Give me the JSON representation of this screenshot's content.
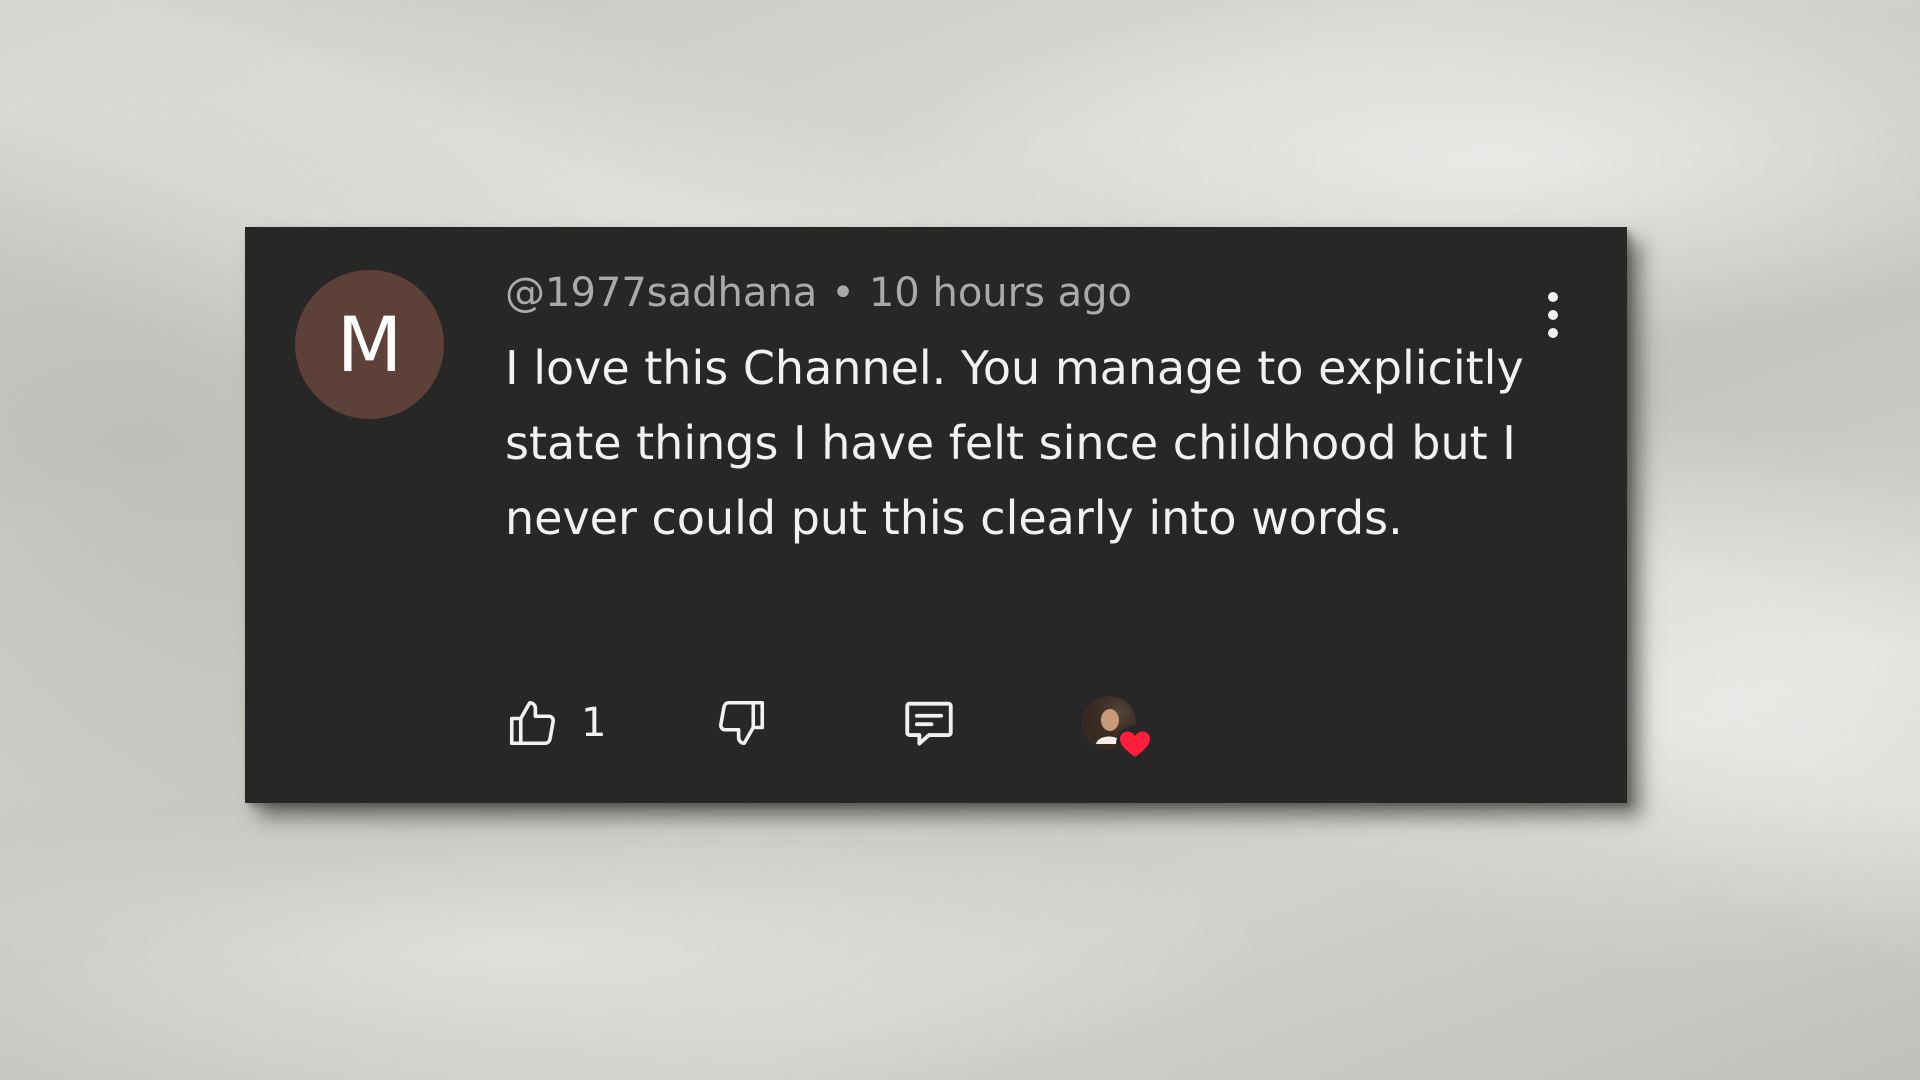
{
  "comment": {
    "avatar_letter": "M",
    "avatar_color": "#5d4037",
    "author": "@1977sadhana",
    "separator": "•",
    "time": "10 hours ago",
    "text": "I love this Channel. You manage to explicitly state things I have felt since childhood but I never could put this clearly into words.",
    "like_count": "1",
    "creator_heart": true
  },
  "icons": {
    "more": "more-vertical-icon",
    "like": "thumbs-up-icon",
    "dislike": "thumbs-down-icon",
    "reply": "reply-comment-icon",
    "heart": "creator-heart-icon"
  },
  "colors": {
    "card_background": "#272727",
    "text_primary": "#f1f1f1",
    "text_secondary": "#aaaaaa",
    "heart": "#ff1f3d"
  }
}
